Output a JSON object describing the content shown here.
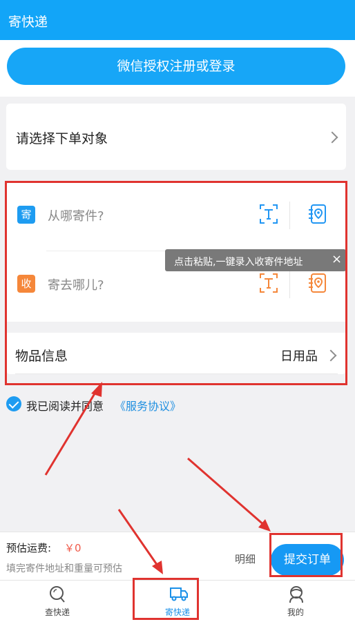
{
  "header": {
    "title": "寄快递"
  },
  "login": {
    "button_label": "微信授权注册或登录"
  },
  "select_target": {
    "label": "请选择下单对象"
  },
  "sender": {
    "badge": "寄",
    "placeholder": "从哪寄件?"
  },
  "receiver": {
    "badge": "收",
    "placeholder": "寄去哪儿?"
  },
  "tooltip": {
    "text": "点击粘贴,一键录入收寄件地址",
    "close_glyph": "×"
  },
  "goods": {
    "label": "物品信息",
    "value": "日用品"
  },
  "agreement": {
    "text": "我已阅读并同意",
    "link": "《服务协议》"
  },
  "estimate": {
    "title": "预估运费:",
    "price": "￥0",
    "note": "填完寄件地址和重量可预估"
  },
  "actions": {
    "detail_label": "明细",
    "submit_label": "提交订单"
  },
  "tabs": [
    {
      "label": "查快递",
      "icon": "search-icon"
    },
    {
      "label": "寄快递",
      "icon": "truck-icon"
    },
    {
      "label": "我的",
      "icon": "user-icon"
    }
  ],
  "colors": {
    "brand": "#12a5f8",
    "sender_badge": "#1e9cf1",
    "receiver_badge": "#f5873a",
    "annotation": "#e0332f"
  }
}
